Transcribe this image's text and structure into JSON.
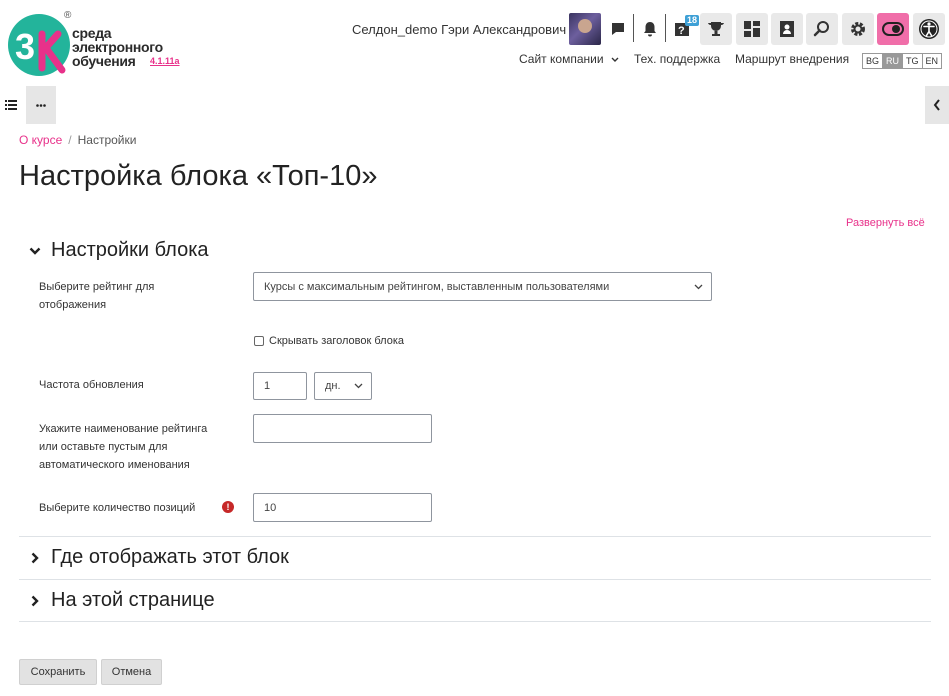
{
  "brand": {
    "logo_mark": "3к",
    "line1": "среда",
    "line2": "электронного",
    "line3": "обучения",
    "version": "4.1.11a",
    "reg": "®",
    "colors": {
      "teal": "#23b49b",
      "pink": "#e8318a"
    }
  },
  "header": {
    "user_name": "Селдон_demo Гэри Александрович",
    "notification_badge": "18",
    "icons": [
      "messages-icon",
      "bell-icon",
      "help-icon",
      "trophy-icon",
      "dashboard-icon",
      "user-card-icon",
      "search-icon",
      "gear-icon",
      "theme-toggle-icon",
      "accessibility-icon"
    ],
    "nav": {
      "company_site": "Сайт компании",
      "support": "Тех. поддержка",
      "route": "Маршрут внедрения"
    },
    "languages": [
      "BG",
      "RU",
      "TG",
      "EN"
    ],
    "active_language": "RU"
  },
  "breadcrumb": {
    "course": "О курсе",
    "separator": "/",
    "current": "Настройки"
  },
  "page": {
    "title": "Настройка блока «Топ-10»",
    "expand_all": "Развернуть всё"
  },
  "sections": {
    "block_settings": "Настройки блока",
    "where_display": "Где отображать этот блок",
    "on_this_page": "На этой странице"
  },
  "form": {
    "rating_label_1": "Выберите рейтинг для",
    "rating_label_2": "отображения",
    "rating_value": "Курсы с максимальным рейтингом, выставленным пользователями",
    "hide_header_label": "Скрывать заголовок блока",
    "refresh_label": "Частота обновления",
    "refresh_value": "1",
    "refresh_unit": "дн.",
    "name_label_1": "Укажите наименование рейтинга",
    "name_label_2": "или оставьте пустым для",
    "name_label_3": "автоматического именования",
    "name_value": "",
    "count_label": "Выберите количество позиций",
    "count_value": "10",
    "required_mark": "!"
  },
  "buttons": {
    "save": "Сохранить",
    "cancel": "Отмена"
  }
}
